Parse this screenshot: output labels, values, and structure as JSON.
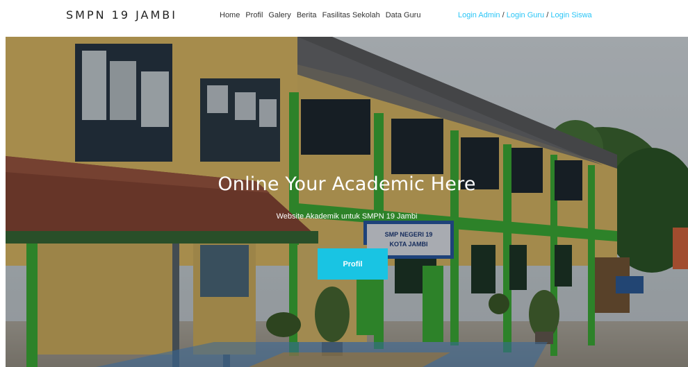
{
  "navbar": {
    "brand": "SMPN 19 JAMBI",
    "links": [
      "Home",
      "Profil",
      "Galery",
      "Berita",
      "Fasilitas Sekolah",
      "Data Guru"
    ],
    "login": {
      "admin": "Login Admin",
      "guru": "Login Guru",
      "siswa": "Login Siswa",
      "separator": "/"
    }
  },
  "hero": {
    "title": "Online Your Academic Here",
    "subtitle": "Website Akademik untuk SMPN 19 Jambi",
    "button_label": "Profil",
    "image": {
      "signboard_line1": "SMP NEGERI 19",
      "signboard_line2": "KOTA JAMBI"
    }
  },
  "colors": {
    "accent": "#19c4e3",
    "login_link": "#29c5f6",
    "wall": "#e2c06a",
    "trim": "#3fb53a",
    "roof": "#6b6b6b"
  }
}
